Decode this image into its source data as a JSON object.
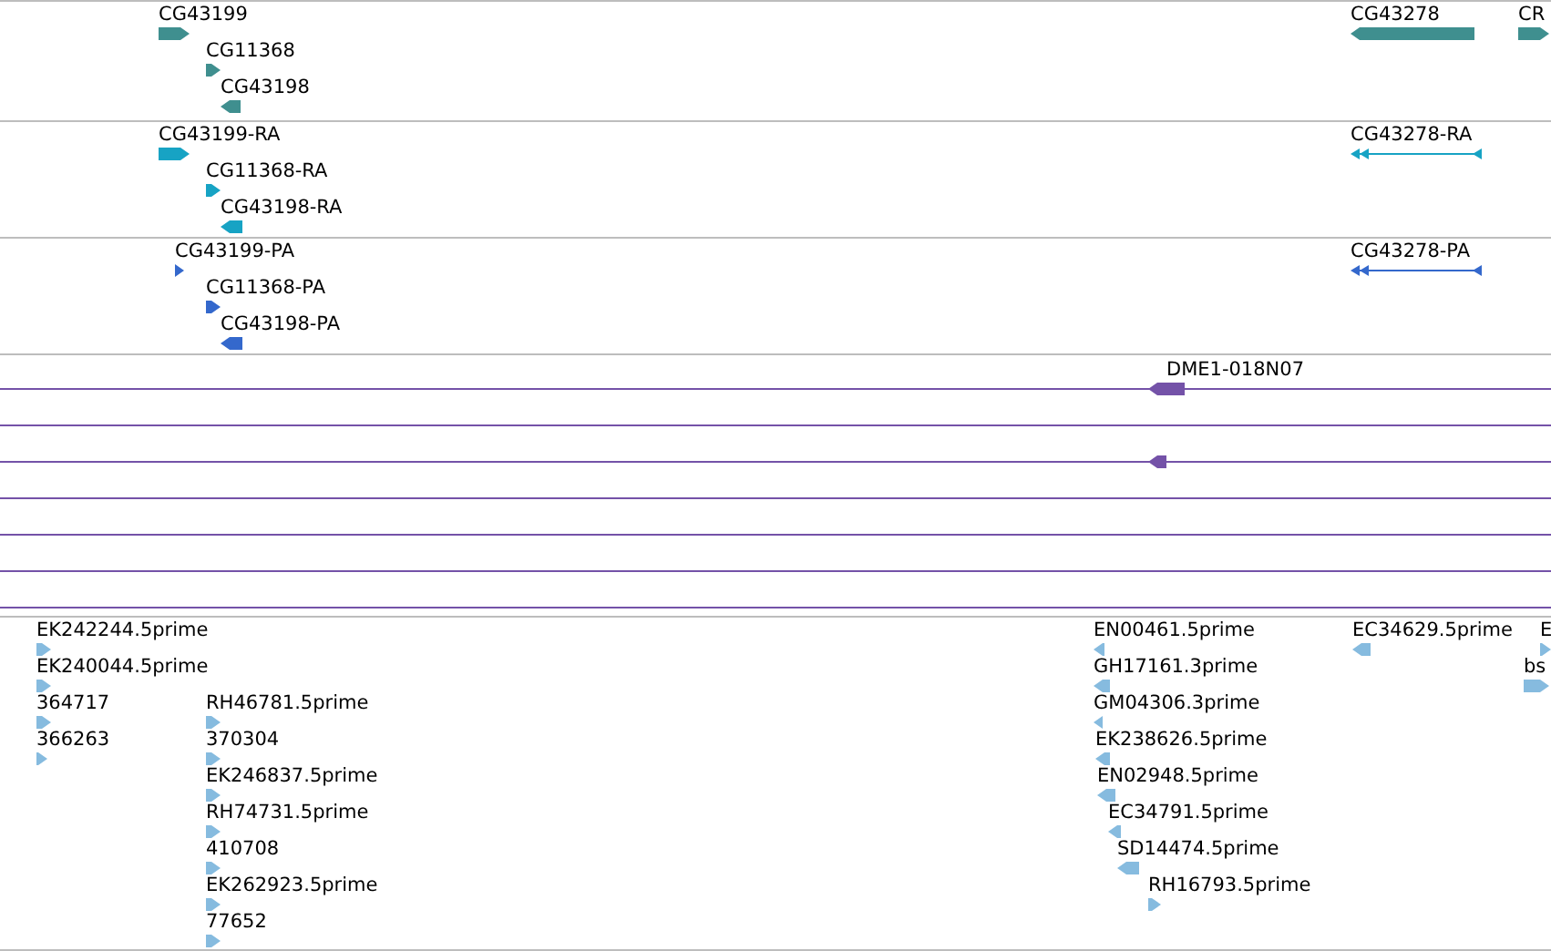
{
  "tracks": [
    {
      "kind": "genes",
      "features": [
        {
          "label": "CG43199",
          "reverse": false,
          "kind": "block"
        },
        {
          "label": "CG11368",
          "reverse": false,
          "kind": "block"
        },
        {
          "label": "CG43198",
          "reverse": true,
          "kind": "block"
        },
        {
          "label": "CG43278",
          "reverse": true,
          "kind": "block"
        },
        {
          "label": "CR",
          "reverse": false,
          "kind": "block"
        }
      ]
    },
    {
      "kind": "transcripts",
      "features": [
        {
          "label": "CG43199-RA",
          "reverse": false,
          "kind": "block"
        },
        {
          "label": "CG11368-RA",
          "reverse": false,
          "kind": "block"
        },
        {
          "label": "CG43198-RA",
          "reverse": true,
          "kind": "block"
        },
        {
          "label": "CG43278-RA",
          "reverse": true,
          "kind": "spliced"
        }
      ]
    },
    {
      "kind": "proteins",
      "features": [
        {
          "label": "CG43199-PA",
          "reverse": false,
          "kind": "block"
        },
        {
          "label": "CG11368-PA",
          "reverse": false,
          "kind": "block"
        },
        {
          "label": "CG43198-PA",
          "reverse": true,
          "kind": "block"
        },
        {
          "label": "CG43278-PA",
          "reverse": true,
          "kind": "spliced"
        }
      ]
    },
    {
      "kind": "clones",
      "features": [
        {
          "label": "DME1-018N07",
          "reverse": true,
          "kind": "block"
        },
        {
          "reverse": true,
          "kind": "block"
        }
      ]
    },
    {
      "kind": "ests",
      "features": [
        {
          "label": "EK242244.5prime",
          "reverse": false,
          "kind": "block"
        },
        {
          "label": "EK240044.5prime",
          "reverse": false,
          "kind": "block"
        },
        {
          "label": "364717",
          "reverse": false,
          "kind": "block"
        },
        {
          "label": "366263",
          "reverse": false,
          "kind": "block"
        },
        {
          "label": "RH46781.5prime",
          "reverse": false,
          "kind": "block"
        },
        {
          "label": "370304",
          "reverse": false,
          "kind": "block"
        },
        {
          "label": "EK246837.5prime",
          "reverse": false,
          "kind": "block"
        },
        {
          "label": "RH74731.5prime",
          "reverse": false,
          "kind": "block"
        },
        {
          "label": "410708",
          "reverse": false,
          "kind": "block"
        },
        {
          "label": "EK262923.5prime",
          "reverse": false,
          "kind": "block"
        },
        {
          "label": "77652",
          "reverse": false,
          "kind": "block"
        },
        {
          "label": "EN00461.5prime",
          "reverse": true,
          "kind": "block"
        },
        {
          "label": "GH17161.3prime",
          "reverse": true,
          "kind": "block"
        },
        {
          "label": "GM04306.3prime",
          "reverse": true,
          "kind": "block"
        },
        {
          "label": "EK238626.5prime",
          "reverse": true,
          "kind": "block"
        },
        {
          "label": "EN02948.5prime",
          "reverse": true,
          "kind": "block"
        },
        {
          "label": "EC34791.5prime",
          "reverse": true,
          "kind": "block"
        },
        {
          "label": "SD14474.5prime",
          "reverse": true,
          "kind": "block"
        },
        {
          "label": "RH16793.5prime",
          "reverse": false,
          "kind": "block"
        },
        {
          "label": "EC34629.5prime",
          "reverse": true,
          "kind": "block"
        },
        {
          "label": "E",
          "reverse": false,
          "kind": "block"
        },
        {
          "label": "bs",
          "reverse": false,
          "kind": "block"
        }
      ]
    }
  ]
}
